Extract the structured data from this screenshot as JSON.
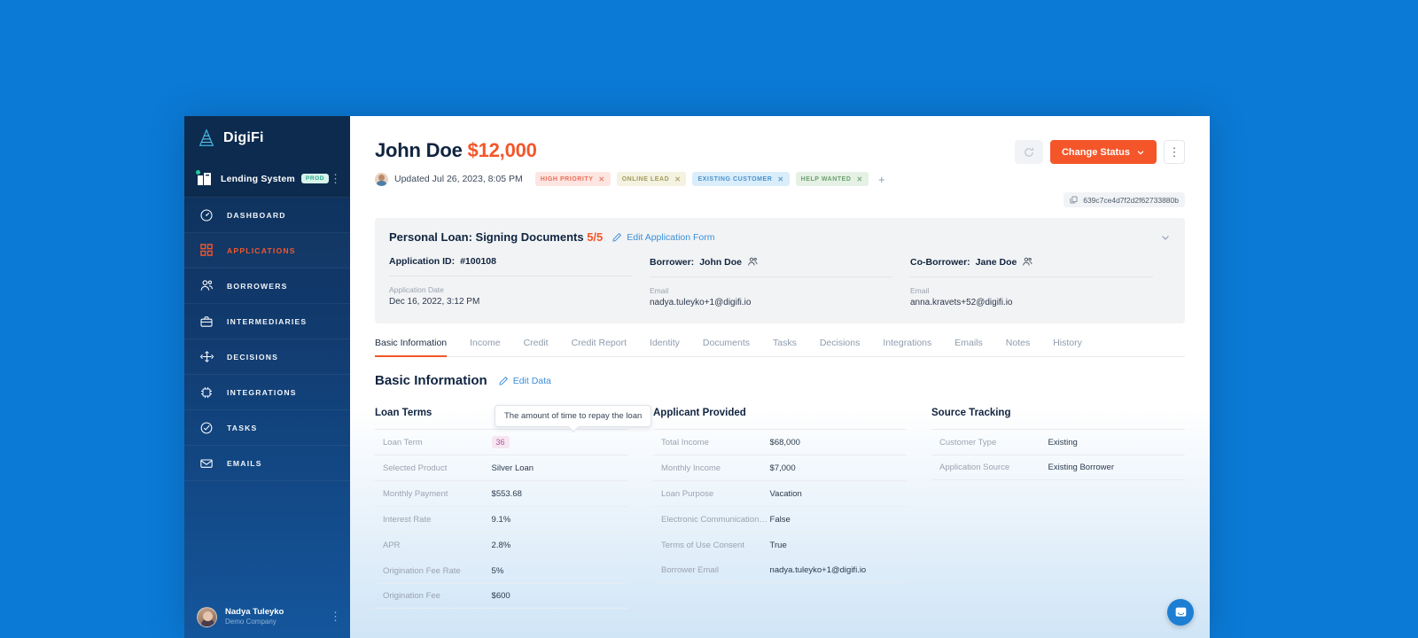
{
  "sidebar": {
    "brand": "DigiFi",
    "workspace": {
      "name": "Lending System",
      "badge": "PROD"
    },
    "nav": [
      {
        "label": "DASHBOARD",
        "icon": "gauge-icon",
        "active": false
      },
      {
        "label": "APPLICATIONS",
        "icon": "grid-icon",
        "active": true
      },
      {
        "label": "BORROWERS",
        "icon": "people-icon",
        "active": false
      },
      {
        "label": "INTERMEDIARIES",
        "icon": "briefcase-icon",
        "active": false
      },
      {
        "label": "DECISIONS",
        "icon": "decision-node-icon",
        "active": false
      },
      {
        "label": "INTEGRATIONS",
        "icon": "chip-icon",
        "active": false
      },
      {
        "label": "TASKS",
        "icon": "check-circle-icon",
        "active": false
      },
      {
        "label": "EMAILS",
        "icon": "envelope-icon",
        "active": false
      }
    ],
    "user": {
      "name": "Nadya Tuleyko",
      "company": "Demo Company"
    }
  },
  "header": {
    "name": "John Doe",
    "amount": "$12,000",
    "updated": "Updated Jul 26, 2023, 8:05 PM",
    "tags": [
      {
        "label": "HIGH PRIORITY",
        "bg": "#fde5e1",
        "color": "#e8705a"
      },
      {
        "label": "ONLINE LEAD",
        "bg": "#f4f2e1",
        "color": "#a39a5c"
      },
      {
        "label": "EXISTING CUSTOMER",
        "bg": "#daedfb",
        "color": "#4a93cc"
      },
      {
        "label": "HELP WANTED",
        "bg": "#e4f1e4",
        "color": "#6fa072"
      }
    ],
    "add_tag": "+",
    "refresh_label": "refresh",
    "change_status": "Change Status",
    "more_label": "more",
    "record_id": "639c7ce4d7f2d2f62733880b"
  },
  "info_panel": {
    "title": "Personal Loan: Signing Documents",
    "progress": "5/5",
    "edit_link": "Edit Application Form",
    "columns": [
      {
        "head_label": "Application ID:",
        "head_value": "#100108",
        "has_person_icon": false,
        "sub_label": "Application Date",
        "sub_value": "Dec 16, 2022, 3:12 PM"
      },
      {
        "head_label": "Borrower:",
        "head_value": "John Doe",
        "has_person_icon": true,
        "sub_label": "Email",
        "sub_value": "nadya.tuleyko+1@digifi.io"
      },
      {
        "head_label": "Co-Borrower:",
        "head_value": "Jane Doe",
        "has_person_icon": true,
        "sub_label": "Email",
        "sub_value": "anna.kravets+52@digifi.io"
      }
    ]
  },
  "tabs": [
    {
      "label": "Basic Information",
      "active": true
    },
    {
      "label": "Income",
      "active": false
    },
    {
      "label": "Credit",
      "active": false
    },
    {
      "label": "Credit Report",
      "active": false
    },
    {
      "label": "Identity",
      "active": false
    },
    {
      "label": "Documents",
      "active": false
    },
    {
      "label": "Tasks",
      "active": false
    },
    {
      "label": "Decisions",
      "active": false
    },
    {
      "label": "Integrations",
      "active": false
    },
    {
      "label": "Emails",
      "active": false
    },
    {
      "label": "Notes",
      "active": false
    },
    {
      "label": "History",
      "active": false
    }
  ],
  "section": {
    "title": "Basic Information",
    "edit_link": "Edit Data",
    "columns": [
      {
        "head": "Loan Terms",
        "rows": [
          {
            "key": "Loan Term",
            "value": "36",
            "pill": true
          },
          {
            "key": "Selected Product",
            "value": "Silver Loan",
            "pill": false
          },
          {
            "key": "Monthly Payment",
            "value": "$553.68",
            "pill": false
          },
          {
            "key": "Interest Rate",
            "value": "9.1%",
            "pill": false
          },
          {
            "key": "APR",
            "value": "2.8%",
            "pill": false
          },
          {
            "key": "Origination Fee Rate",
            "value": "5%",
            "pill": false
          },
          {
            "key": "Origination Fee",
            "value": "$600",
            "pill": false
          }
        ]
      },
      {
        "head": "Applicant Provided",
        "rows": [
          {
            "key": "Total Income",
            "value": "$68,000",
            "pill": false
          },
          {
            "key": "Monthly Income",
            "value": "$7,000",
            "pill": false
          },
          {
            "key": "Loan Purpose",
            "value": "Vacation",
            "pill": false
          },
          {
            "key": "Electronic Communications C...",
            "value": "False",
            "pill": false
          },
          {
            "key": "Terms of Use Consent",
            "value": "True",
            "pill": false
          },
          {
            "key": "Borrower Email",
            "value": "nadya.tuleyko+1@digifi.io",
            "pill": false
          }
        ]
      },
      {
        "head": "Source Tracking",
        "rows": [
          {
            "key": "Customer Type",
            "value": "Existing",
            "pill": false
          },
          {
            "key": "Application Source",
            "value": "Existing Borrower",
            "pill": false
          }
        ]
      }
    ]
  },
  "tooltip": {
    "text": "The amount of time to repay the loan"
  },
  "intercom": {
    "label": "messenger-launcher"
  },
  "colors": {
    "accent": "#f4562a",
    "link": "#3a8fd9",
    "sidebar_dark": "#0c2b4e",
    "desktop_bg": "#0b7ad6"
  }
}
